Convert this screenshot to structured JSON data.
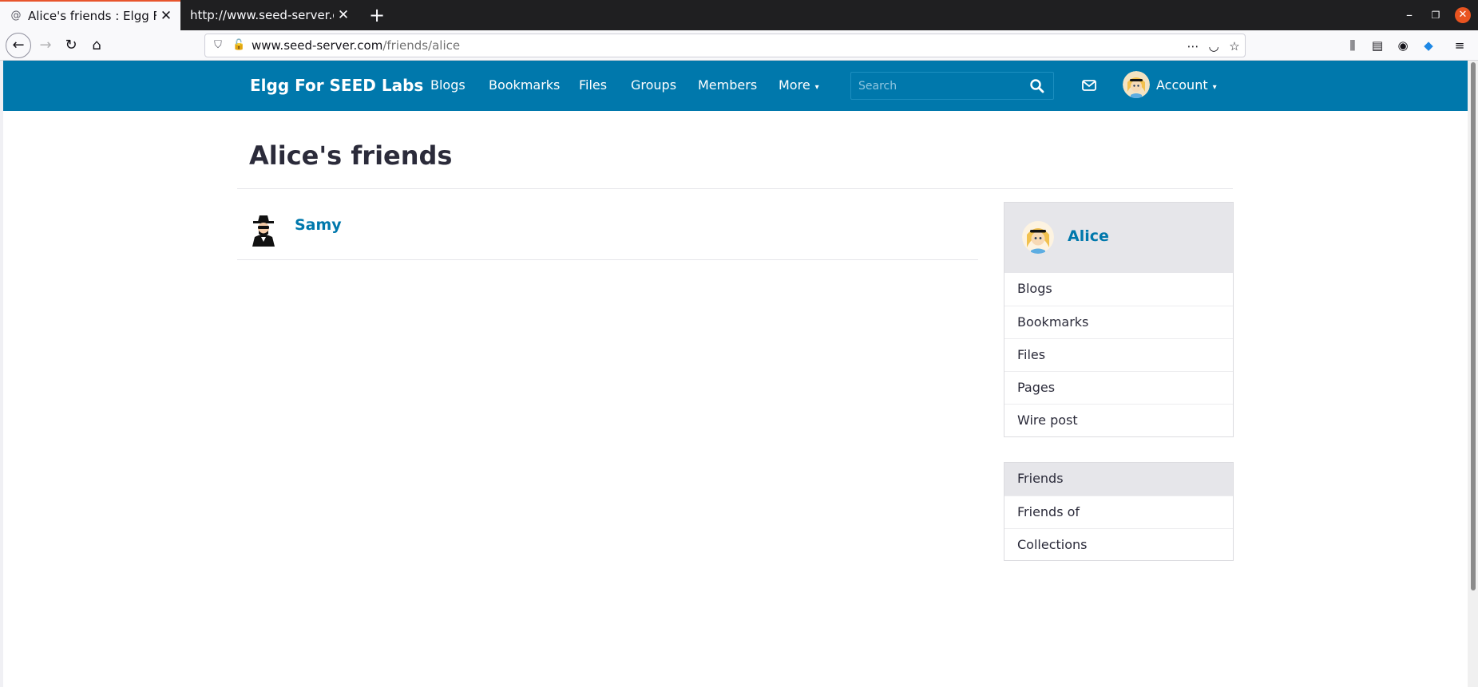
{
  "browser": {
    "tabs": [
      {
        "title": "Alice's friends : Elgg For SEED Labs",
        "active": true
      },
      {
        "title": "http://www.seed-server.com",
        "active": false
      }
    ],
    "url_host": "www.seed-server.com",
    "url_path": "/friends/alice",
    "icons": [
      "back-arrow-icon",
      "forward-arrow-icon",
      "reload-icon",
      "home-icon",
      "shield-icon",
      "insecure-lock-icon",
      "more-actions-icon",
      "pocket-icon",
      "bookmark-star-icon",
      "library-icon",
      "sidebar-icon",
      "account-icon",
      "extension-icon",
      "menu-icon"
    ]
  },
  "site": {
    "brand": "Elgg For SEED Labs",
    "menu": [
      "Blogs",
      "Bookmarks",
      "Files",
      "Groups",
      "Members"
    ],
    "more_label": "More",
    "search_placeholder": "Search",
    "account_label": "Account",
    "accent_color": "#0078ac"
  },
  "main": {
    "title": "Alice's friends",
    "friends": [
      {
        "name": "Samy"
      }
    ]
  },
  "owner": {
    "name": "Alice",
    "links": [
      "Blogs",
      "Bookmarks",
      "Files",
      "Pages",
      "Wire post"
    ]
  },
  "filters": {
    "items": [
      "Friends",
      "Friends of",
      "Collections"
    ],
    "selected": "Friends"
  }
}
